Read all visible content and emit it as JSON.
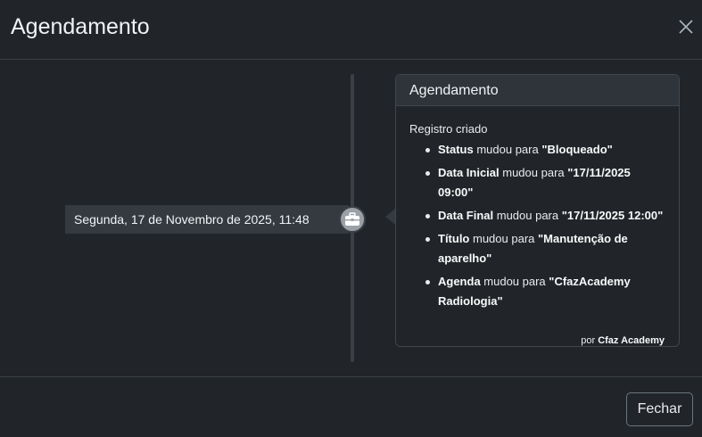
{
  "modal": {
    "title": "Agendamento",
    "close_icon": "close-icon",
    "footer": {
      "close_label": "Fechar"
    }
  },
  "timeline": {
    "date_label": "Segunda, 17 de Novembro de 2025, 11:48",
    "badge_icon": "briefcase-icon",
    "card": {
      "header": "Agendamento",
      "intro": "Registro criado",
      "changes": [
        {
          "field": "Status",
          "text": " mudou para ",
          "value": "\"Bloqueado\""
        },
        {
          "field": "Data Inicial",
          "text": " mudou para ",
          "value": "\"17/11/2025 09:00\""
        },
        {
          "field": "Data Final",
          "text": " mudou para ",
          "value": "\"17/11/2025 12:00\""
        },
        {
          "field": "Título",
          "text": " mudou para ",
          "value": "\"Manutenção de aparelho\""
        },
        {
          "field": "Agenda",
          "text": " mudou para ",
          "value": "\"CfazAcademy Radiologia\""
        }
      ],
      "author_prefix": "por ",
      "author_name": "Cfaz Academy"
    }
  },
  "colors": {
    "background": "#212529",
    "card_header": "#2f343a",
    "date_label_bg": "#343a40",
    "badge": "#9aa0a6"
  }
}
